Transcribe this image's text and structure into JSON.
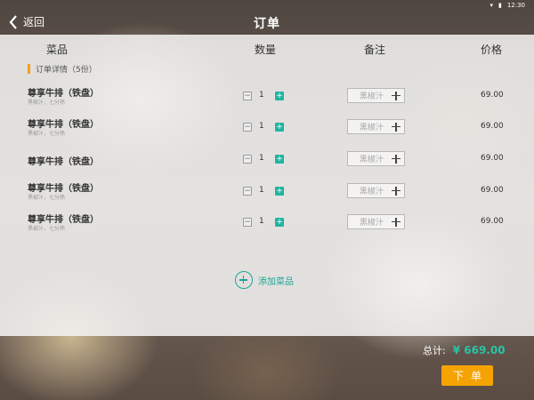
{
  "status": {
    "time": "12:30"
  },
  "header": {
    "back_label": "返回",
    "title": "订单"
  },
  "columns": {
    "dish": "菜品",
    "qty": "数量",
    "note": "备注",
    "price": "价格"
  },
  "section": {
    "label": "订单详情（5份）"
  },
  "items": [
    {
      "name": "尊享牛排（铁盘）",
      "sub": "黑椒汁，七分熟",
      "qty": "1",
      "note": "黑椒汁",
      "price": "69.00"
    },
    {
      "name": "尊享牛排（铁盘）",
      "sub": "黑椒汁，七分熟",
      "qty": "1",
      "note": "黑椒汁",
      "price": "69.00"
    },
    {
      "name": "尊享牛排（铁盘）",
      "sub": "",
      "qty": "1",
      "note": "黑椒汁",
      "price": "69.00"
    },
    {
      "name": "尊享牛排（铁盘）",
      "sub": "黑椒汁，七分熟",
      "qty": "1",
      "note": "黑椒汁",
      "price": "69.00"
    },
    {
      "name": "尊享牛排（铁盘）",
      "sub": "黑椒汁，七分熟",
      "qty": "1",
      "note": "黑椒汁",
      "price": "69.00"
    }
  ],
  "add_dish": {
    "label": "添加菜品"
  },
  "footer": {
    "total_label": "总计:",
    "total_value": "¥ 669.00",
    "submit_label": "下单"
  },
  "colors": {
    "accent": "#22b4a0",
    "submit": "#f5a300",
    "section_bar": "#f4a01c"
  }
}
